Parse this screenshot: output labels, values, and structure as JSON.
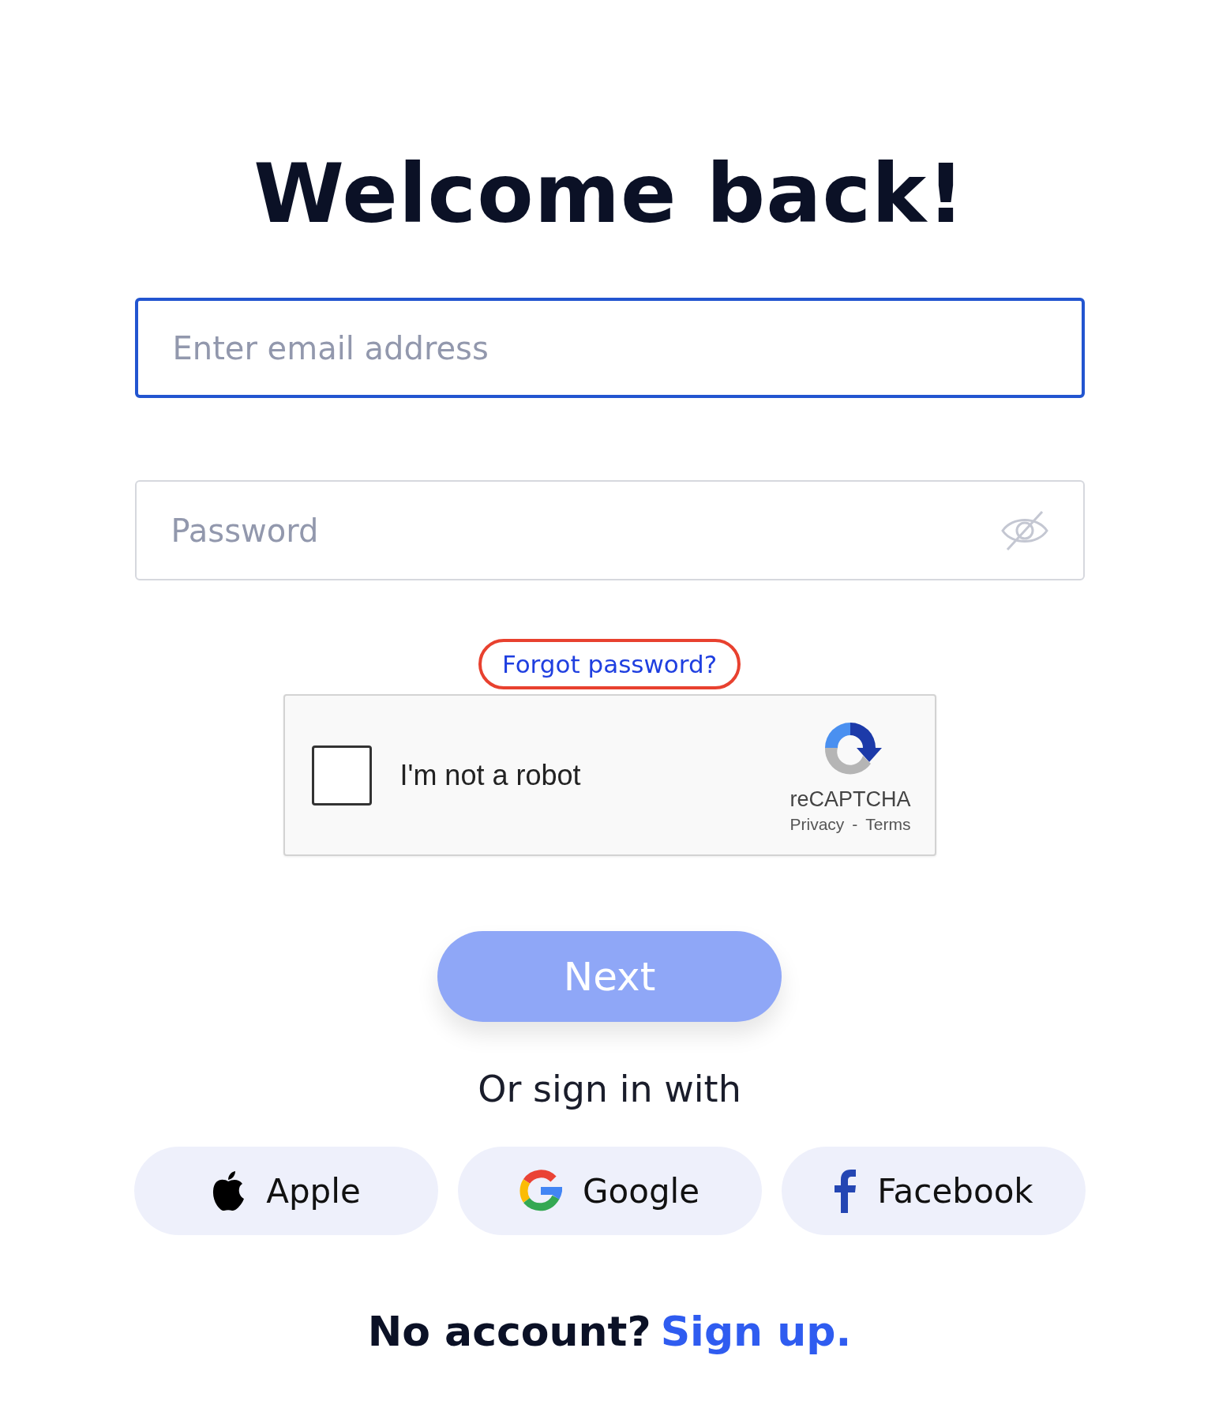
{
  "title": "Welcome back!",
  "email": {
    "placeholder": "Enter email address",
    "focused": true
  },
  "password": {
    "placeholder": "Password",
    "focused": false
  },
  "forgot_link": {
    "label": "Forgot password?",
    "highlighted": true
  },
  "captcha": {
    "label": "I'm not a robot",
    "checked": false,
    "brand": "reCAPTCHA",
    "links": [
      "Privacy",
      "Terms"
    ],
    "separator": "-"
  },
  "next_button": {
    "label": "Next",
    "disabled": true
  },
  "social_heading": "Or sign in with",
  "social_buttons": [
    {
      "kind": "apple",
      "label": "Apple"
    },
    {
      "kind": "google",
      "label": "Google"
    },
    {
      "kind": "facebook",
      "label": "Facebook"
    }
  ],
  "footer": {
    "text": "No account?",
    "link": "Sign up."
  }
}
